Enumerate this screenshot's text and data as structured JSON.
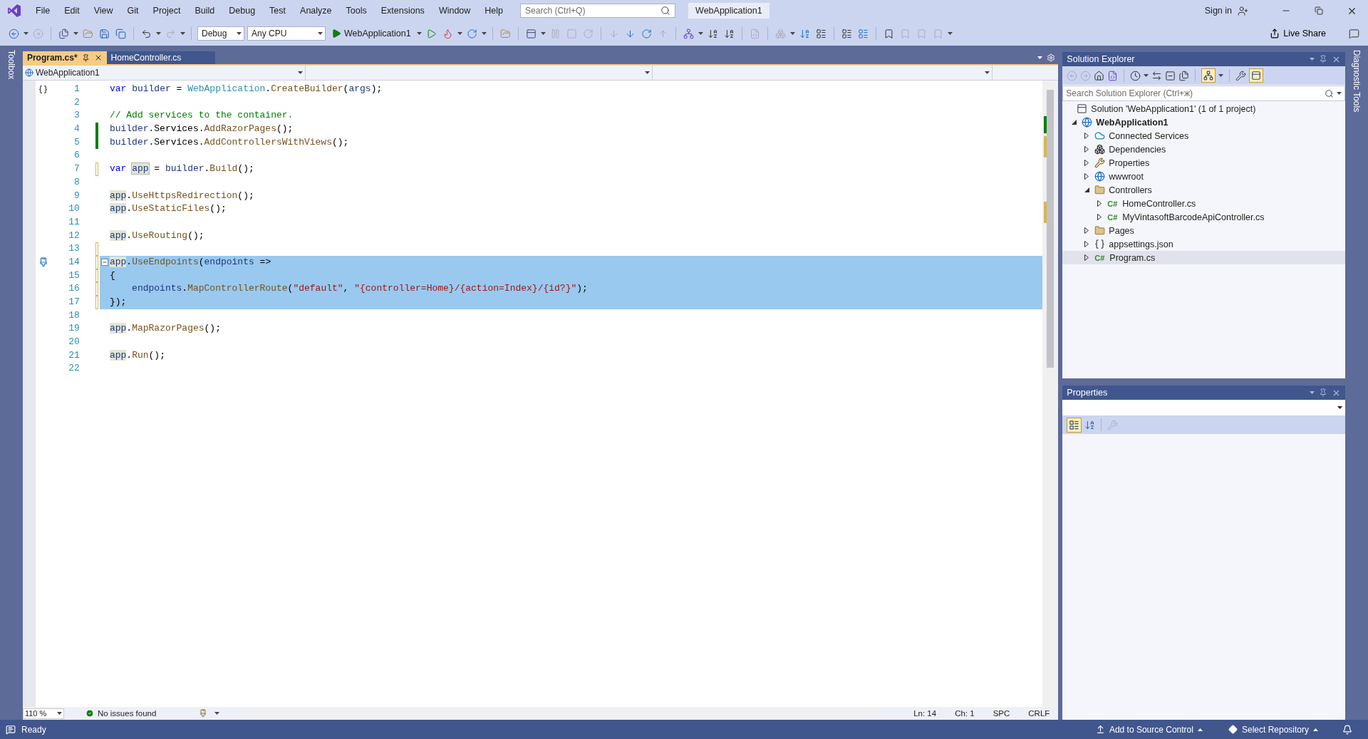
{
  "menu": [
    "File",
    "Edit",
    "View",
    "Git",
    "Project",
    "Build",
    "Debug",
    "Test",
    "Analyze",
    "Tools",
    "Extensions",
    "Window",
    "Help"
  ],
  "search": {
    "placeholder": "Search (Ctrl+Q)"
  },
  "solution_name": "WebApplication1",
  "sign_in": "Sign in",
  "toolbar": {
    "configuration": "Debug",
    "platform": "Any CPU",
    "run_target": "WebApplication1",
    "live_share": "Live Share"
  },
  "side_tabs": {
    "left": "Toolbox",
    "right": "Diagnostic Tools"
  },
  "tabs": [
    {
      "label": "Program.cs*",
      "selected": true
    },
    {
      "label": "HomeController.cs",
      "selected": false
    }
  ],
  "nav_bar": {
    "project": "WebApplication1"
  },
  "code_lines": [
    {
      "number": "1",
      "selected": false,
      "gutter_icon": {
        "kind": "braces"
      },
      "tokens": [
        {
          "kind": "keyword",
          "text": "var "
        },
        {
          "kind": "local",
          "text": "builder"
        },
        {
          "kind": "plain",
          "text": " = "
        },
        {
          "kind": "type",
          "text": "WebApplication"
        },
        {
          "kind": "plain",
          "text": "."
        },
        {
          "kind": "method",
          "text": "CreateBuilder"
        },
        {
          "kind": "plain",
          "text": "("
        },
        {
          "kind": "param",
          "text": "args"
        },
        {
          "kind": "plain",
          "text": ");"
        }
      ]
    },
    {
      "number": "2",
      "selected": false
    },
    {
      "number": "3",
      "selected": false,
      "tokens": [
        {
          "kind": "comment",
          "text": "// Add services to the container."
        }
      ]
    },
    {
      "number": "4",
      "selected": false,
      "marker": {
        "kind": "saved"
      },
      "tokens": [
        {
          "kind": "local",
          "text": "builder"
        },
        {
          "kind": "plain",
          "text": ".Services."
        },
        {
          "kind": "method",
          "text": "AddRazorPages"
        },
        {
          "kind": "plain",
          "text": "();"
        }
      ]
    },
    {
      "number": "5",
      "selected": false,
      "marker": {
        "kind": "saved"
      },
      "tokens": [
        {
          "kind": "local",
          "text": "builder"
        },
        {
          "kind": "plain",
          "text": ".Services."
        },
        {
          "kind": "method",
          "text": "AddControllersWithViews"
        },
        {
          "kind": "plain",
          "text": "();"
        }
      ]
    },
    {
      "number": "6",
      "selected": false
    },
    {
      "number": "7",
      "selected": false,
      "marker": {
        "kind": "unsaved"
      },
      "tokens": [
        {
          "kind": "keyword",
          "text": "var "
        },
        {
          "kind": "definition",
          "text": "app"
        },
        {
          "kind": "plain",
          "text": " = "
        },
        {
          "kind": "local",
          "text": "builder"
        },
        {
          "kind": "plain",
          "text": "."
        },
        {
          "kind": "method",
          "text": "Build"
        },
        {
          "kind": "plain",
          "text": "();"
        }
      ]
    },
    {
      "number": "8",
      "selected": false
    },
    {
      "number": "9",
      "selected": false,
      "tokens": [
        {
          "kind": "reference",
          "text": "app"
        },
        {
          "kind": "plain",
          "text": "."
        },
        {
          "kind": "method",
          "text": "UseHttpsRedirection"
        },
        {
          "kind": "plain",
          "text": "();"
        }
      ]
    },
    {
      "number": "10",
      "selected": false,
      "tokens": [
        {
          "kind": "reference",
          "text": "app"
        },
        {
          "kind": "plain",
          "text": "."
        },
        {
          "kind": "method",
          "text": "UseStaticFiles"
        },
        {
          "kind": "plain",
          "text": "();"
        }
      ]
    },
    {
      "number": "11",
      "selected": false
    },
    {
      "number": "12",
      "selected": false,
      "tokens": [
        {
          "kind": "reference",
          "text": "app"
        },
        {
          "kind": "plain",
          "text": "."
        },
        {
          "kind": "method",
          "text": "UseRouting"
        },
        {
          "kind": "plain",
          "text": "();"
        }
      ]
    },
    {
      "number": "13",
      "selected": false,
      "marker": {
        "kind": "unsaved"
      }
    },
    {
      "number": "14",
      "selected": true,
      "marker": {
        "kind": "unsaved"
      },
      "gutter_icon": {
        "kind": "brush"
      },
      "fold_expanded": true,
      "tokens": [
        {
          "kind": "reference",
          "text": "app"
        },
        {
          "kind": "plain",
          "text": "."
        },
        {
          "kind": "method",
          "text": "UseEndpoints"
        },
        {
          "kind": "plain",
          "text": "("
        },
        {
          "kind": "param",
          "text": "endpoints"
        },
        {
          "kind": "plain",
          "text": " =>"
        }
      ]
    },
    {
      "number": "15",
      "selected": true,
      "marker": {
        "kind": "unsaved"
      },
      "tokens": [
        {
          "kind": "plain",
          "text": "{"
        }
      ]
    },
    {
      "number": "16",
      "selected": true,
      "marker": {
        "kind": "unsaved"
      },
      "tokens": [
        {
          "kind": "param",
          "text": "    endpoints"
        },
        {
          "kind": "plain",
          "text": "."
        },
        {
          "kind": "method",
          "text": "MapControllerRoute"
        },
        {
          "kind": "plain",
          "text": "("
        },
        {
          "kind": "string",
          "text": "\"default\""
        },
        {
          "kind": "plain",
          "text": ", "
        },
        {
          "kind": "string",
          "text": "\"{controller=Home}/{action=Index}/{id?}\""
        },
        {
          "kind": "plain",
          "text": ");"
        }
      ]
    },
    {
      "number": "17",
      "selected": true,
      "marker": {
        "kind": "unsaved"
      },
      "tokens": [
        {
          "kind": "plain",
          "text": "});"
        }
      ]
    },
    {
      "number": "18",
      "selected": false
    },
    {
      "number": "19",
      "selected": false,
      "tokens": [
        {
          "kind": "reference",
          "text": "app"
        },
        {
          "kind": "plain",
          "text": "."
        },
        {
          "kind": "method",
          "text": "MapRazorPages"
        },
        {
          "kind": "plain",
          "text": "();"
        }
      ]
    },
    {
      "number": "20",
      "selected": false
    },
    {
      "number": "21",
      "selected": false,
      "tokens": [
        {
          "kind": "reference",
          "text": "app"
        },
        {
          "kind": "plain",
          "text": "."
        },
        {
          "kind": "method",
          "text": "Run"
        },
        {
          "kind": "plain",
          "text": "();"
        }
      ]
    },
    {
      "number": "22",
      "selected": false
    }
  ],
  "editor_status": {
    "zoom": "110 %",
    "issues": "No issues found",
    "line": "Ln: 14",
    "column": "Ch: 1",
    "whitespace": "SPC",
    "line_ending": "CRLF"
  },
  "solution_explorer": {
    "title": "Solution Explorer",
    "tree_filter_on": true,
    "preview_on": true,
    "search_placeholder": "Search Solution Explorer (Ctrl+ж)",
    "tree": [
      {
        "label": "Solution 'WebApplication1' (1 of 1 project)",
        "kind": "solution",
        "selected": false,
        "children": [
          {
            "label": "WebApplication1",
            "kind": "project",
            "selected": false,
            "expanded": true,
            "children": [
              {
                "label": "Connected Services",
                "kind": "connected",
                "selected": false,
                "expanded": false
              },
              {
                "label": "Dependencies",
                "kind": "dependencies",
                "selected": false,
                "expanded": false
              },
              {
                "label": "Properties",
                "kind": "properties",
                "selected": false,
                "expanded": false
              },
              {
                "label": "wwwroot",
                "kind": "web",
                "selected": false,
                "expanded": false
              },
              {
                "label": "Controllers",
                "kind": "folder",
                "selected": false,
                "expanded": true,
                "children": [
                  {
                    "label": "HomeController.cs",
                    "kind": "csharp",
                    "icon_text": "C#",
                    "selected": false,
                    "expanded": false
                  },
                  {
                    "label": "MyVintasoftBarcodeApiController.cs",
                    "kind": "csharp",
                    "icon_text": "C#",
                    "selected": false,
                    "expanded": false
                  }
                ]
              },
              {
                "label": "Pages",
                "kind": "folder",
                "selected": false,
                "expanded": false
              },
              {
                "label": "appsettings.json",
                "kind": "json",
                "selected": false,
                "expanded": false
              },
              {
                "label": "Program.cs",
                "kind": "csharp",
                "icon_text": "C#",
                "selected": true,
                "expanded": false
              }
            ]
          }
        ]
      }
    ]
  },
  "properties": {
    "title": "Properties",
    "categorized_on": true
  },
  "status_bar": {
    "ready": "Ready",
    "source_control": "Add to Source Control",
    "repository": "Select Repository"
  }
}
